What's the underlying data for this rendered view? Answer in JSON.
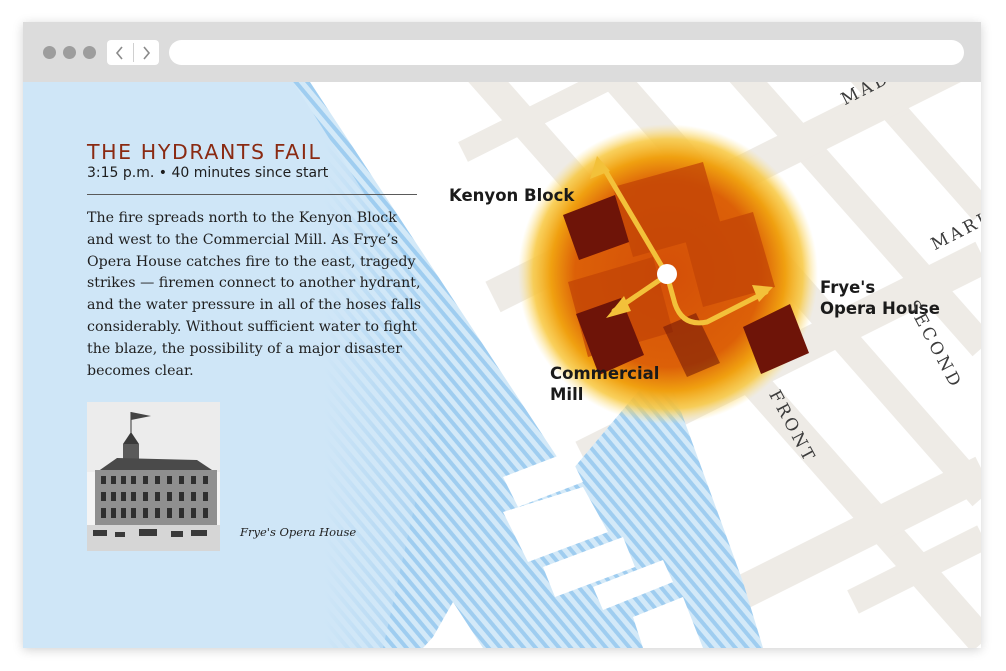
{
  "story": {
    "title": "THE HYDRANTS FAIL",
    "subtitle": "3:15 p.m. • 40 minutes since start",
    "body": "The fire spreads north to the Kenyon Block and west to the Commercial Mill. As Frye’s Opera House catches fire to the east, tragedy strikes — firemen connect to another hydrant, and the water pressure in all of the hoses falls considerably. Without sufficient water to fight the blaze, the possibility of a major disaster becomes clear.",
    "photo_caption": "Frye's Opera House"
  },
  "map": {
    "labels": {
      "kenyon": "Kenyon Block",
      "frye_1": "Frye's",
      "frye_2": "Opera House",
      "commercial_1": "Commercial",
      "commercial_2": "Mill"
    },
    "streets": {
      "madison": "MAD",
      "marion": "MARI",
      "second": "SECOND",
      "front": "FRONT"
    },
    "colors": {
      "water": "#cfe6f7",
      "road": "#eeebe6",
      "fire": "#d9580a",
      "building": "#6e1408",
      "arrow": "#f3c13a"
    }
  },
  "browser": {
    "icons": [
      "back-icon",
      "forward-icon"
    ]
  }
}
